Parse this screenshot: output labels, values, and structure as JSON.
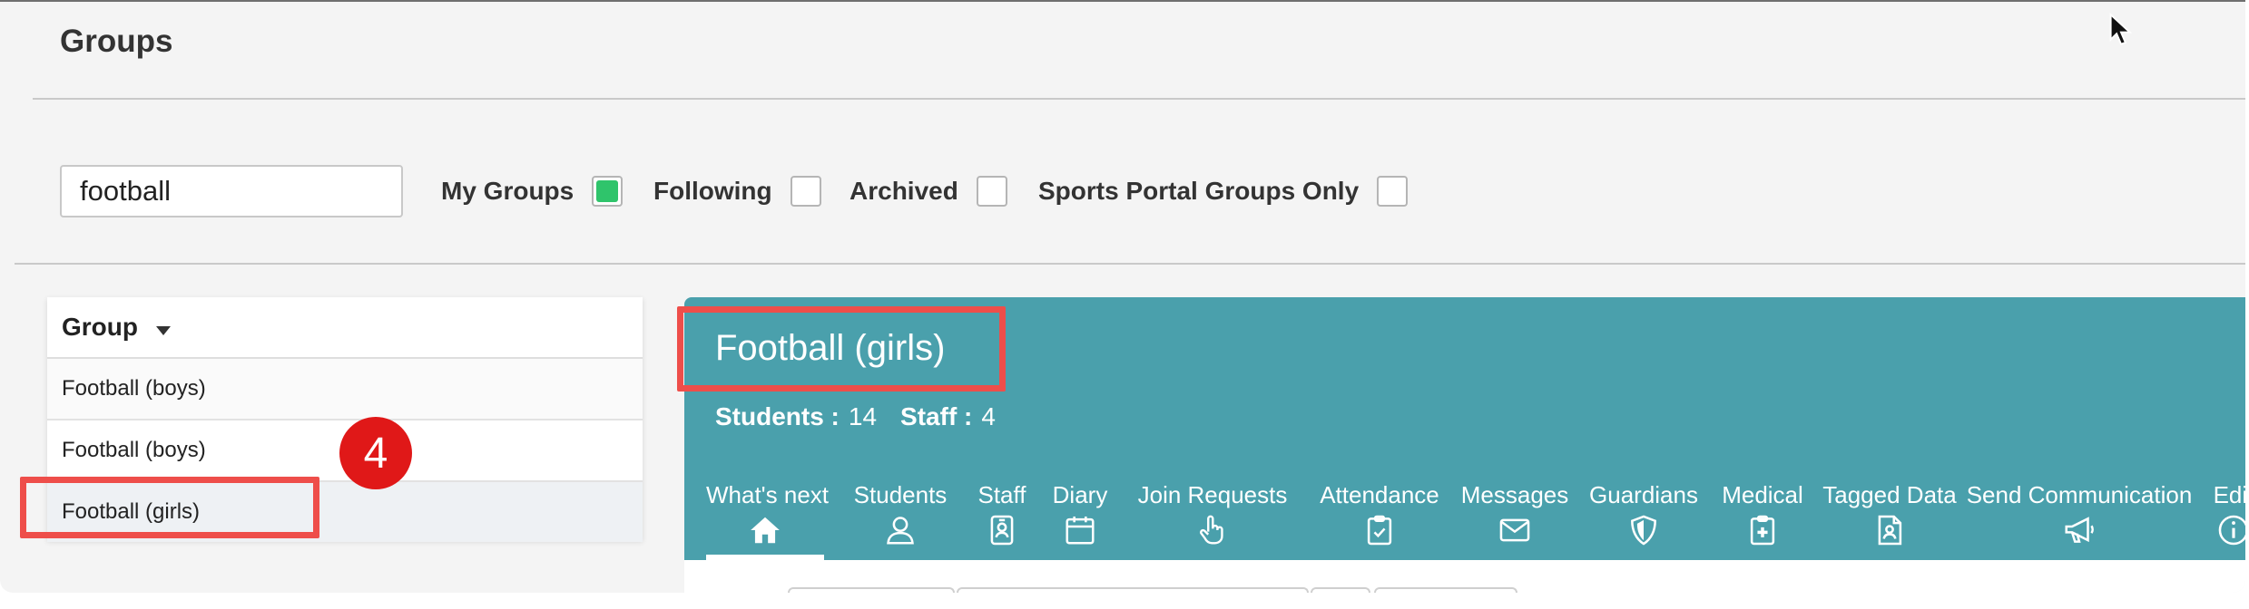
{
  "page": {
    "title": "Groups"
  },
  "search": {
    "value": "football"
  },
  "filters": [
    {
      "label": "My Groups",
      "checked": true
    },
    {
      "label": "Following",
      "checked": false
    },
    {
      "label": "Archived",
      "checked": false
    },
    {
      "label": "Sports Portal Groups Only",
      "checked": false
    }
  ],
  "group_table": {
    "header": "Group",
    "rows": [
      "Football (boys)",
      "Football (boys)",
      "Football (girls)"
    ],
    "selected_index": 2
  },
  "annotation": {
    "step": "4",
    "highlight_color": "#ee4e4a",
    "badge_color": "#e01818"
  },
  "group_panel": {
    "title": "Football (girls)",
    "students_label": "Students :",
    "students_value": "14",
    "staff_label": "Staff :",
    "staff_value": "4",
    "accent": "#4aa0ac",
    "tabs": [
      {
        "label": "What's next",
        "icon": "home-icon",
        "active": true
      },
      {
        "label": "Students",
        "icon": "person-icon"
      },
      {
        "label": "Staff",
        "icon": "id-badge-icon"
      },
      {
        "label": "Diary",
        "icon": "calendar-icon"
      },
      {
        "label": "Join Requests",
        "icon": "pointing-hand-icon"
      },
      {
        "label": "Attendance",
        "icon": "clipboard-check-icon"
      },
      {
        "label": "Messages",
        "icon": "envelope-icon"
      },
      {
        "label": "Guardians",
        "icon": "shield-icon"
      },
      {
        "label": "Medical",
        "icon": "medical-clipboard-icon"
      },
      {
        "label": "Tagged Data",
        "icon": "tagged-document-icon"
      },
      {
        "label": "Send Communication",
        "icon": "megaphone-icon"
      },
      {
        "label": "Edit",
        "icon": "info-icon"
      }
    ]
  }
}
